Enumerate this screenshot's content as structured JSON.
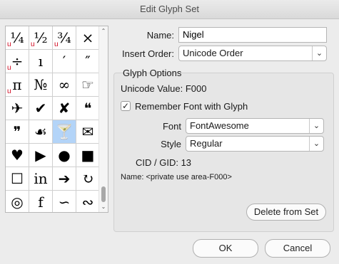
{
  "window": {
    "title": "Edit Glyph Set"
  },
  "glyph_grid": {
    "cells": [
      {
        "glyph": "¼",
        "mark": "u"
      },
      {
        "glyph": "½",
        "mark": "u"
      },
      {
        "glyph": "¾",
        "mark": "u"
      },
      {
        "glyph": "×",
        "mark": ""
      },
      {
        "glyph": "÷",
        "mark": "u"
      },
      {
        "glyph": "ı",
        "mark": ""
      },
      {
        "glyph": "′",
        "mark": ""
      },
      {
        "glyph": "″",
        "mark": ""
      },
      {
        "glyph": "π",
        "mark": "u"
      },
      {
        "glyph": "№",
        "mark": ""
      },
      {
        "glyph": "∞",
        "mark": ""
      },
      {
        "glyph": "☞",
        "mark": ""
      },
      {
        "glyph": "✈",
        "mark": ""
      },
      {
        "glyph": "✔",
        "mark": ""
      },
      {
        "glyph": "✘",
        "mark": ""
      },
      {
        "glyph": "❝",
        "mark": ""
      },
      {
        "glyph": "❞",
        "mark": ""
      },
      {
        "glyph": "☙",
        "mark": ""
      },
      {
        "glyph": "🍸",
        "mark": "",
        "selected": true
      },
      {
        "glyph": "✉",
        "mark": ""
      },
      {
        "glyph": "♥",
        "mark": ""
      },
      {
        "glyph": "▶",
        "mark": ""
      },
      {
        "glyph": "●",
        "mark": ""
      },
      {
        "glyph": "■",
        "mark": ""
      },
      {
        "glyph": "☐",
        "mark": ""
      },
      {
        "glyph": "in",
        "mark": ""
      },
      {
        "glyph": "➔",
        "mark": ""
      },
      {
        "glyph": "↻",
        "mark": ""
      },
      {
        "glyph": "◎",
        "mark": ""
      },
      {
        "glyph": "f",
        "mark": ""
      },
      {
        "glyph": "∽",
        "mark": ""
      },
      {
        "glyph": "∾",
        "mark": ""
      }
    ],
    "scroll_up": "⌃",
    "scroll_down": "⌄"
  },
  "form": {
    "name_label": "Name:",
    "name_value": "Nigel",
    "insert_order_label": "Insert Order:",
    "insert_order_value": "Unicode Order",
    "caret": "⌄"
  },
  "glyph_options": {
    "title": "Glyph Options",
    "unicode_label": "Unicode Value:",
    "unicode_value": "F000",
    "remember_font_label": "Remember Font with Glyph",
    "remember_font_checked": "✓",
    "font_label": "Font",
    "font_value": "FontAwesome",
    "style_label": "Style",
    "style_value": "Regular",
    "cid_label": "CID / GID:",
    "cid_value": "13",
    "name_label": "Name:",
    "name_value": "<private use area-F000>",
    "delete_button": "Delete from Set"
  },
  "buttons": {
    "ok": "OK",
    "cancel": "Cancel"
  }
}
